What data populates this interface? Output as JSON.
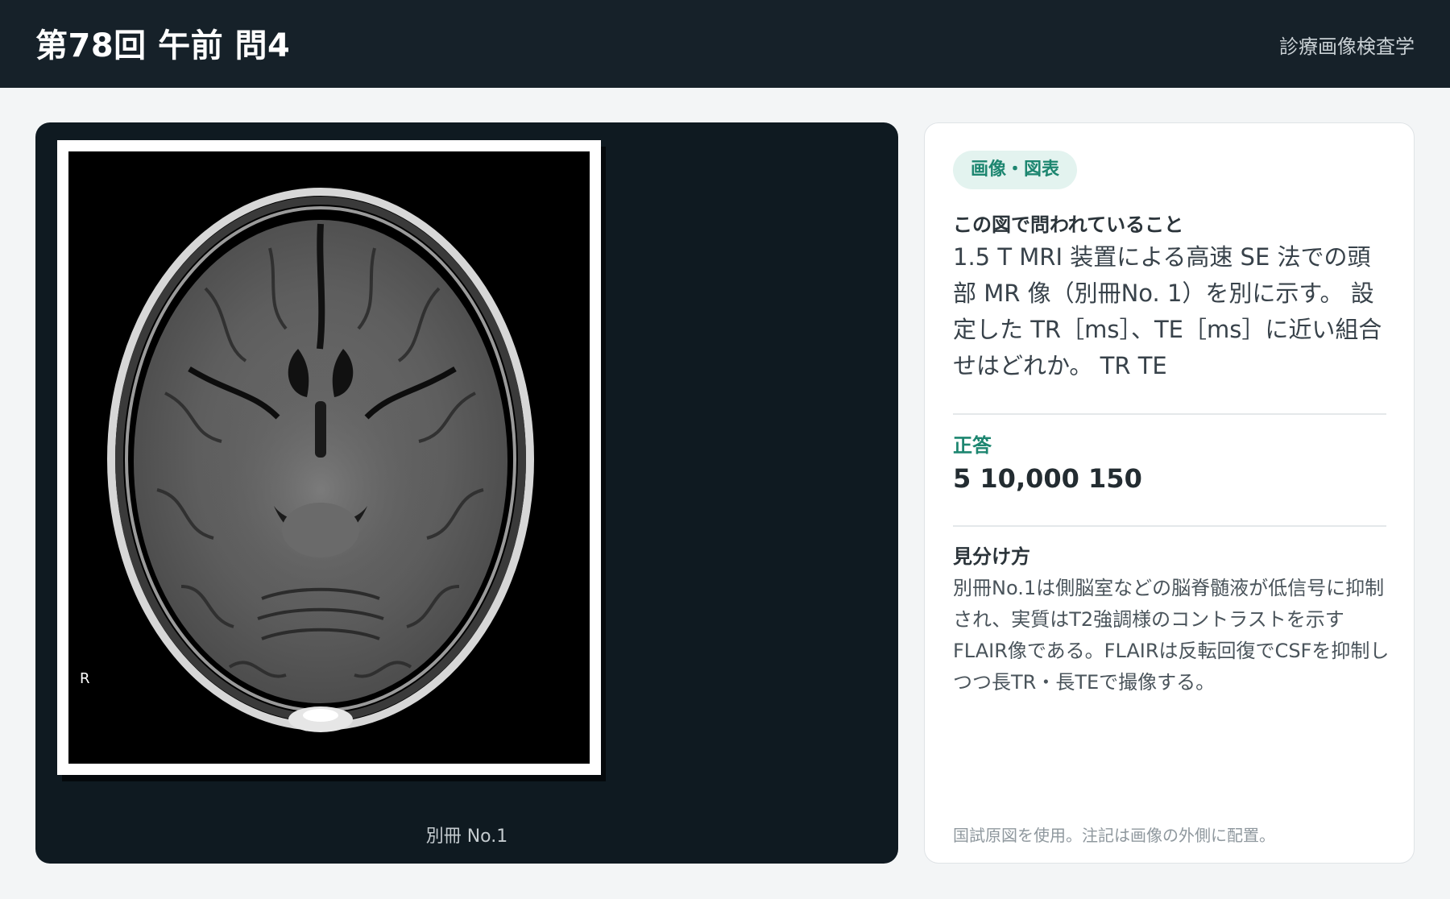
{
  "header": {
    "title": "第78回 午前 問4",
    "subject": "診療画像検査学"
  },
  "figure": {
    "orientation_marker": "R",
    "caption": "別冊 No.1"
  },
  "card": {
    "tag": "画像・図表",
    "question_label": "この図で問われていること",
    "question_text": "1.5 T MRI 装置による高速 SE 法での頭部 MR 像（別冊No. 1）を別に示す。 設定した TR［ms］、TE［ms］に近い組合せはどれか。 TR TE",
    "answer_label": "正答",
    "answer_text": "5 10,000 150",
    "explanation_label": "見分け方",
    "explanation_text": "別冊No.1は側脳室などの脳脊髄液が低信号に抑制され、実質はT2強調様のコントラストを示すFLAIR像である。FLAIRは反転回復でCSFを抑制しつつ長TR・長TEで撮像する。",
    "footnote": "国試原図を使用。注記は画像の外側に配置。"
  },
  "colors": {
    "header_bg": "#162129",
    "panel_bg": "#0f1a21",
    "accent_green": "#1d8670",
    "tag_bg": "#e3f3ef",
    "page_bg": "#f3f5f6"
  }
}
